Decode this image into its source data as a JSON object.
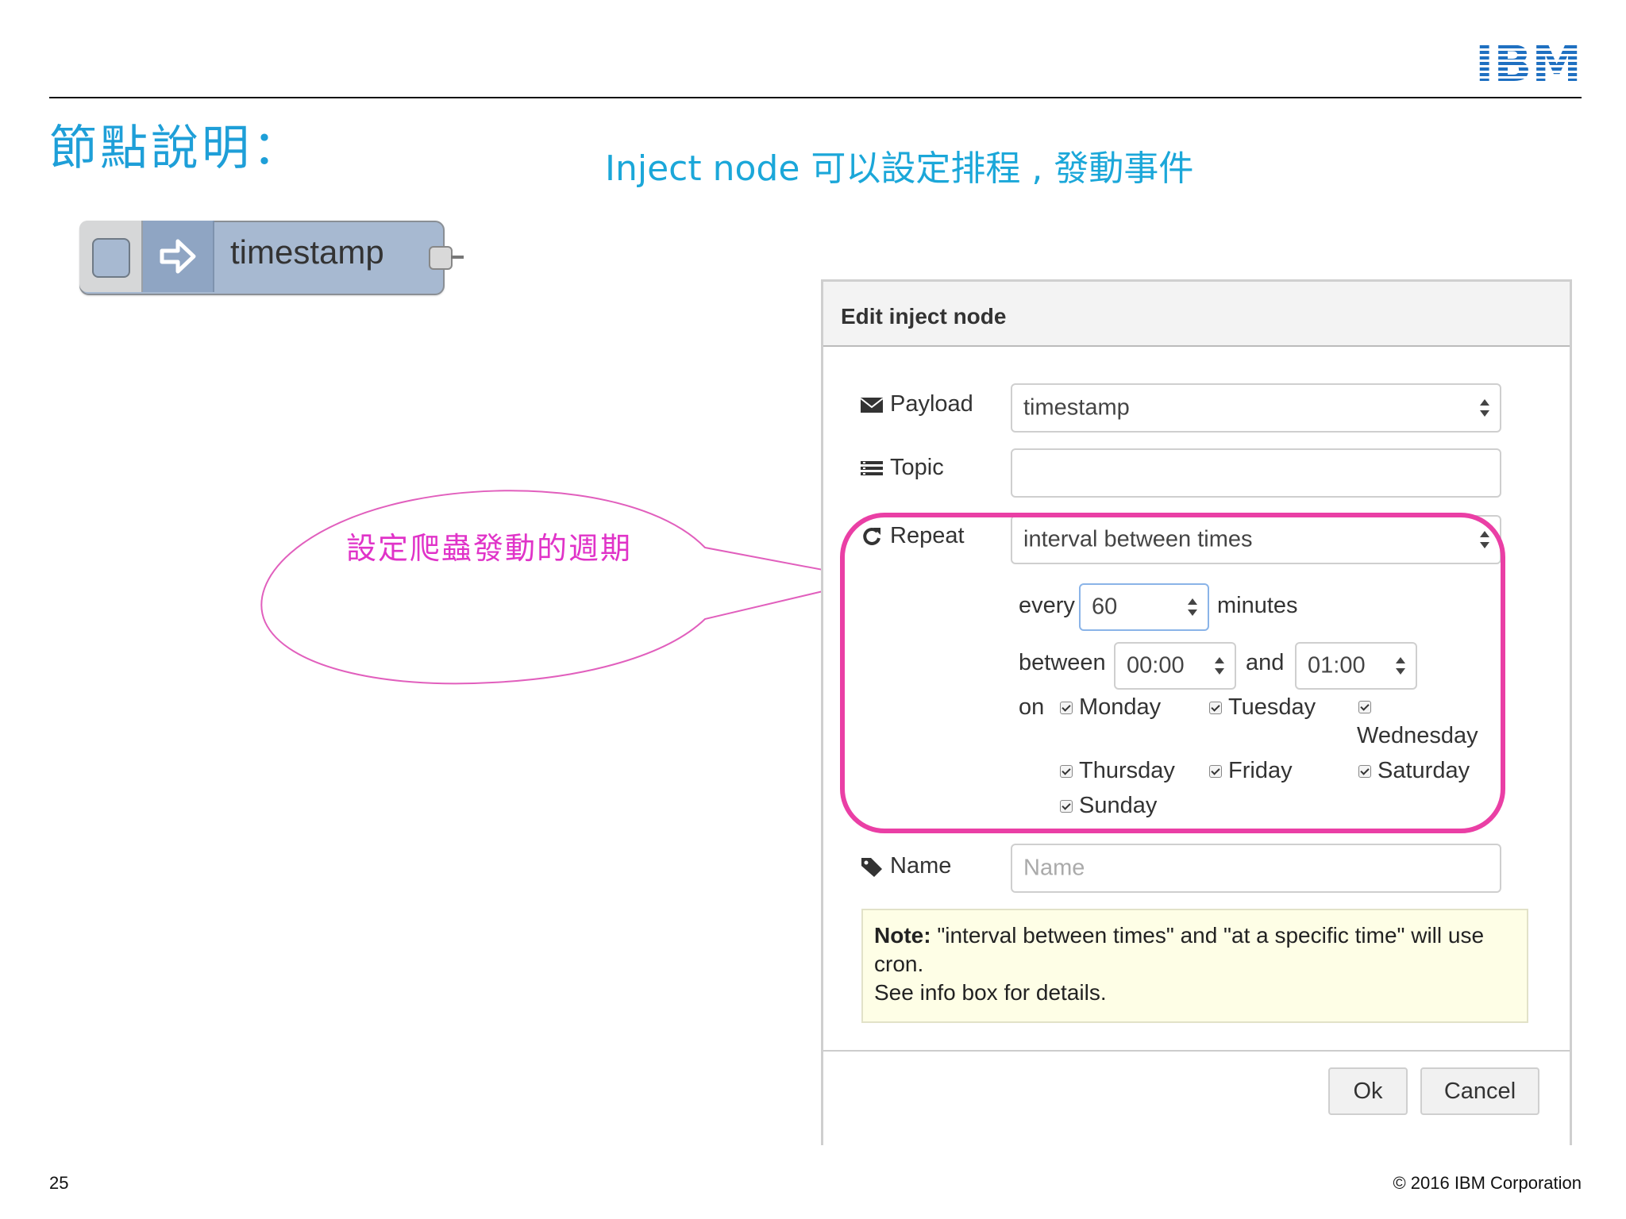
{
  "slide": {
    "title": "節點說明：",
    "subtitle": "Inject node  可以設定排程 , 發動事件",
    "page_number": "25",
    "copyright": "© 2016 IBM Corporation",
    "logo_text": "IBM"
  },
  "node": {
    "label": "timestamp"
  },
  "callout": {
    "text": "設定爬蟲發動的週期"
  },
  "dialog": {
    "title": "Edit inject node",
    "payload": {
      "label": "Payload",
      "value": "timestamp"
    },
    "topic": {
      "label": "Topic",
      "value": ""
    },
    "repeat": {
      "label": "Repeat",
      "value": "interval between times"
    },
    "interval": {
      "every_label": "every",
      "every_value": "60",
      "unit": "minutes",
      "between_label": "between",
      "start": "00:00",
      "and_label": "and",
      "end": "01:00",
      "on_label": "on"
    },
    "days": [
      {
        "label": "Monday",
        "checked": true
      },
      {
        "label": "Tuesday",
        "checked": true
      },
      {
        "label": "Wednesday",
        "checked": true
      },
      {
        "label": "Thursday",
        "checked": true
      },
      {
        "label": "Friday",
        "checked": true
      },
      {
        "label": "Saturday",
        "checked": true
      },
      {
        "label": "Sunday",
        "checked": true
      }
    ],
    "name": {
      "label": "Name",
      "placeholder": "Name",
      "value": ""
    },
    "note": {
      "bold": "Note:",
      "text": " \"interval between times\" and \"at a specific time\" will use cron.",
      "line2": "See info box for details."
    },
    "buttons": {
      "ok": "Ok",
      "cancel": "Cancel"
    }
  },
  "colors": {
    "title_blue": "#1e9fd8",
    "callout_magenta": "#e033c8",
    "highlight_pink": "#ea3fa5",
    "node_blue": "#a7b9d1",
    "note_bg": "#fefee6"
  },
  "icons": [
    "envelope-icon",
    "list-icon",
    "refresh-icon",
    "tag-icon",
    "arrow-right-icon",
    "spinner-arrows-icon"
  ]
}
